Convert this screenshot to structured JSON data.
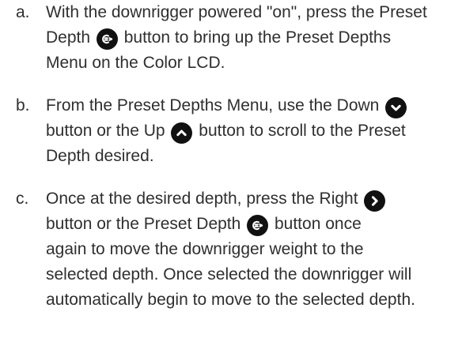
{
  "steps": [
    {
      "marker": "a.",
      "lines": [
        [
          "With the downrigger powered \"on\", press the Preset"
        ],
        [
          "Depth ",
          "preset-depth-icon",
          " button to bring up the Preset Depths"
        ],
        [
          "Menu on the Color LCD."
        ]
      ]
    },
    {
      "marker": "b.",
      "lines": [
        [
          "From the Preset Depths Menu, use the Down ",
          "down-arrow-icon"
        ],
        [
          "button or the Up ",
          "up-arrow-icon",
          " button to scroll to the Preset"
        ],
        [
          "Depth desired."
        ]
      ]
    },
    {
      "marker": "c.",
      "lines": [
        [
          "Once at the desired depth, press the Right ",
          "right-arrow-icon"
        ],
        [
          "button or the Preset Depth ",
          "preset-depth-icon",
          " button once"
        ],
        [
          "again to move the downrigger weight to the"
        ],
        [
          "selected depth. Once selected the downrigger will"
        ],
        [
          "automatically begin to move to the selected depth."
        ]
      ]
    }
  ]
}
